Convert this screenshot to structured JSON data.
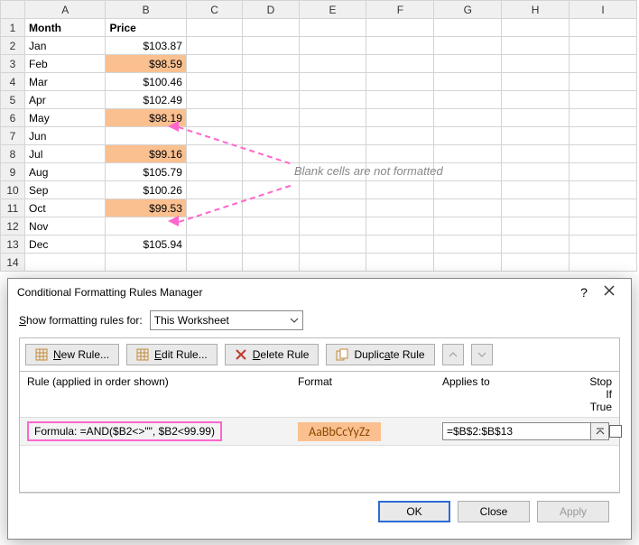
{
  "grid": {
    "columns": [
      "A",
      "B",
      "C",
      "D",
      "E",
      "F",
      "G",
      "H",
      "I"
    ],
    "widths": [
      86,
      86,
      60,
      60,
      72,
      72,
      72,
      72,
      72
    ],
    "row_numbers": [
      1,
      2,
      3,
      4,
      5,
      6,
      7,
      8,
      9,
      10,
      11,
      12,
      13,
      14
    ],
    "headers": {
      "A": "Month",
      "B": "Price"
    },
    "rows": [
      {
        "n": 2,
        "month": "Jan",
        "price": "$103.87",
        "hl": false
      },
      {
        "n": 3,
        "month": "Feb",
        "price": "$98.59",
        "hl": true
      },
      {
        "n": 4,
        "month": "Mar",
        "price": "$100.46",
        "hl": false
      },
      {
        "n": 5,
        "month": "Apr",
        "price": "$102.49",
        "hl": false
      },
      {
        "n": 6,
        "month": "May",
        "price": "$98.19",
        "hl": true
      },
      {
        "n": 7,
        "month": "Jun",
        "price": "",
        "hl": false
      },
      {
        "n": 8,
        "month": "Jul",
        "price": "$99.16",
        "hl": true
      },
      {
        "n": 9,
        "month": "Aug",
        "price": "$105.79",
        "hl": false
      },
      {
        "n": 10,
        "month": "Sep",
        "price": "$100.26",
        "hl": false
      },
      {
        "n": 11,
        "month": "Oct",
        "price": "$99.53",
        "hl": true
      },
      {
        "n": 12,
        "month": "Nov",
        "price": "",
        "hl": false
      },
      {
        "n": 13,
        "month": "Dec",
        "price": "$105.94",
        "hl": false
      }
    ]
  },
  "annotation": {
    "text": "Blank cells are not formatted"
  },
  "dialog": {
    "title": "Conditional Formatting Rules Manager",
    "help": "?",
    "show_label_pre": "S",
    "show_label_post": "how formatting rules for:",
    "scope": "This Worksheet",
    "buttons": {
      "new_pre": "N",
      "new_post": "ew Rule...",
      "edit_pre": "E",
      "edit_post": "dit Rule...",
      "delete_pre": "D",
      "delete_post": "elete Rule",
      "duplicate_pre": "",
      "duplicate_post": "Duplic",
      "duplicate_u": "a",
      "duplicate_tail": "te Rule"
    },
    "cols": {
      "rule": "Rule (applied in order shown)",
      "format": "Format",
      "applies": "Applies to",
      "stop": "Stop If True"
    },
    "rule": {
      "text": "Formula: =AND($B2<>\"\", $B2<99.99)",
      "preview": "AaBbCcYyZz",
      "applies_to": "=$B$2:$B$13",
      "stop": false
    },
    "footer": {
      "ok": "OK",
      "close": "Close",
      "apply": "Apply"
    }
  }
}
